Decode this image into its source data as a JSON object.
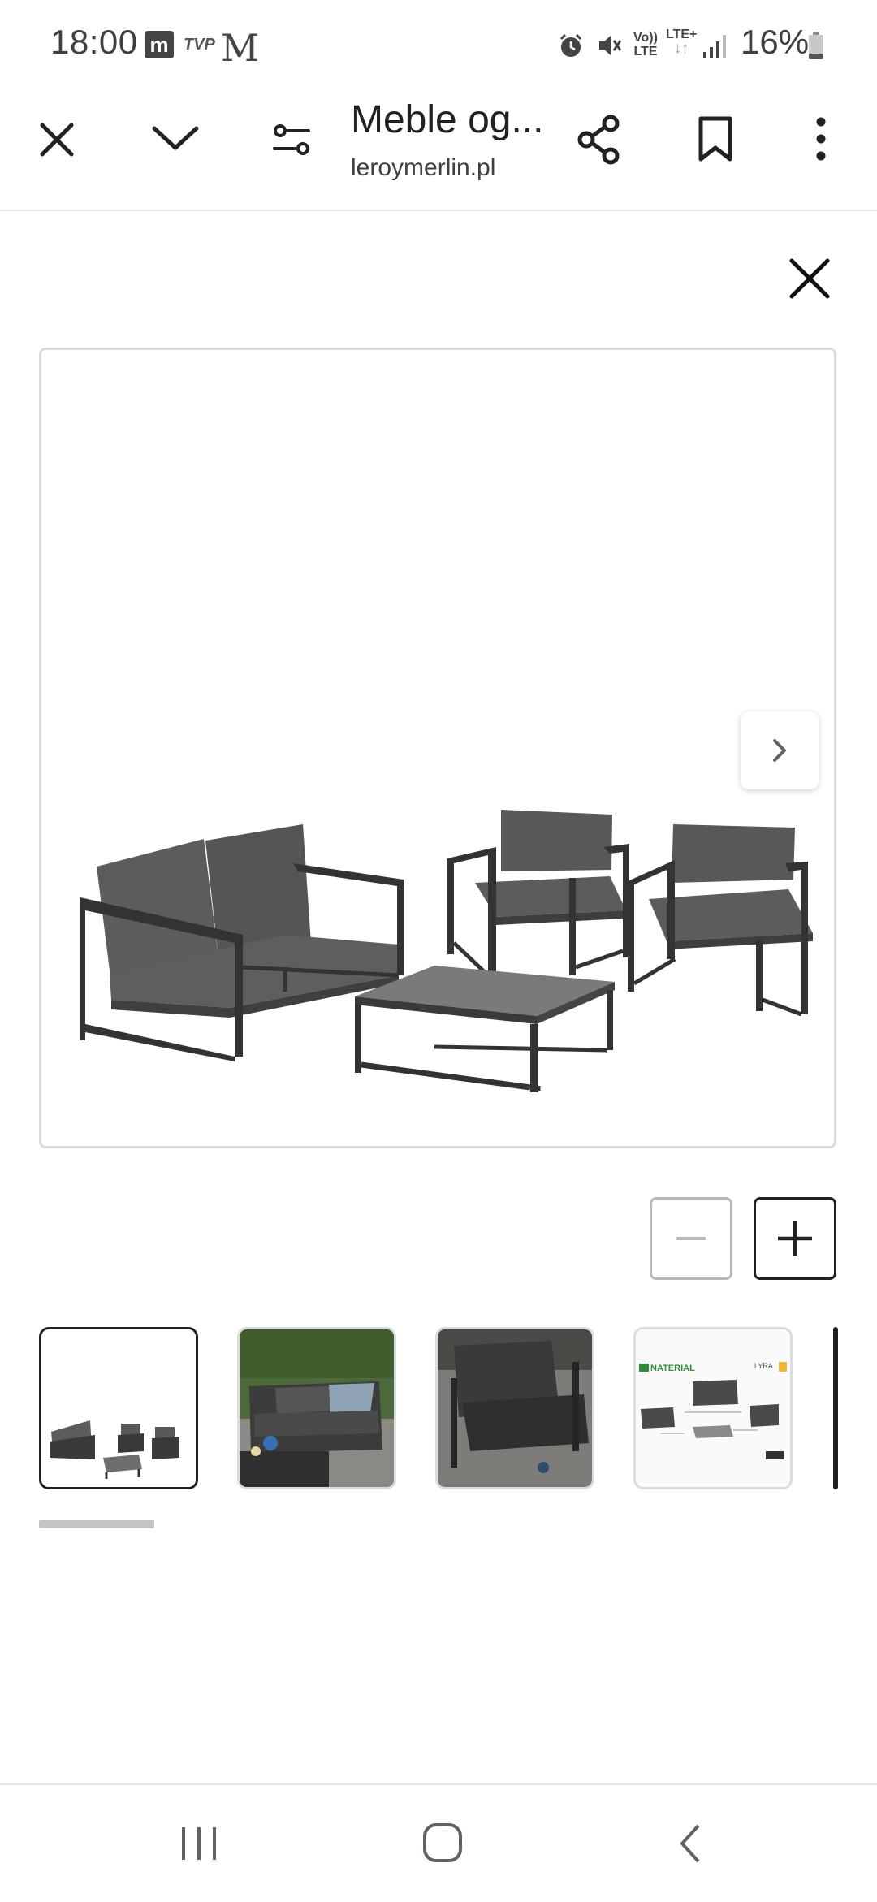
{
  "status_bar": {
    "time": "18:00",
    "left_icons": [
      "m-app-icon",
      "tvp-icon",
      "gmail-m-icon"
    ],
    "tvp_text": "TVP",
    "right_icons": [
      "alarm-icon",
      "mute-icon",
      "volte-icon",
      "lte-plus-icon",
      "signal-icon",
      "battery-icon"
    ],
    "volte_text": "Vo))",
    "lte_text": "LTE",
    "lte_plus_text": "LTE+",
    "battery": "16%"
  },
  "toolbar": {
    "title": "Meble og...",
    "url": "leroymerlin.pl",
    "icons": [
      "close-icon",
      "chevron-down-icon",
      "tune-icon",
      "share-icon",
      "bookmark-icon",
      "more-vert-icon"
    ]
  },
  "viewer": {
    "close_icon": "close-icon",
    "next_icon": "chevron-right-icon",
    "image_alt": "garden furniture set: sofa, two armchairs, table",
    "zoom_out_icon": "minus-icon",
    "zoom_in_icon": "plus-icon"
  },
  "thumbnails": [
    {
      "selected": true,
      "kind": "product-white"
    },
    {
      "selected": false,
      "kind": "sofa-outdoor"
    },
    {
      "selected": false,
      "kind": "armchair-outdoor"
    },
    {
      "selected": false,
      "kind": "dimensions-sheet",
      "brand": "NATERIAL",
      "tag": "LYRA"
    }
  ],
  "nav_bar": {
    "icons": [
      "recents-icon",
      "home-icon",
      "back-icon"
    ]
  },
  "colors": {
    "frame_border": "#dadce0",
    "furniture_frame": "#3a3a3a",
    "cushion": "#5a5a5a"
  }
}
